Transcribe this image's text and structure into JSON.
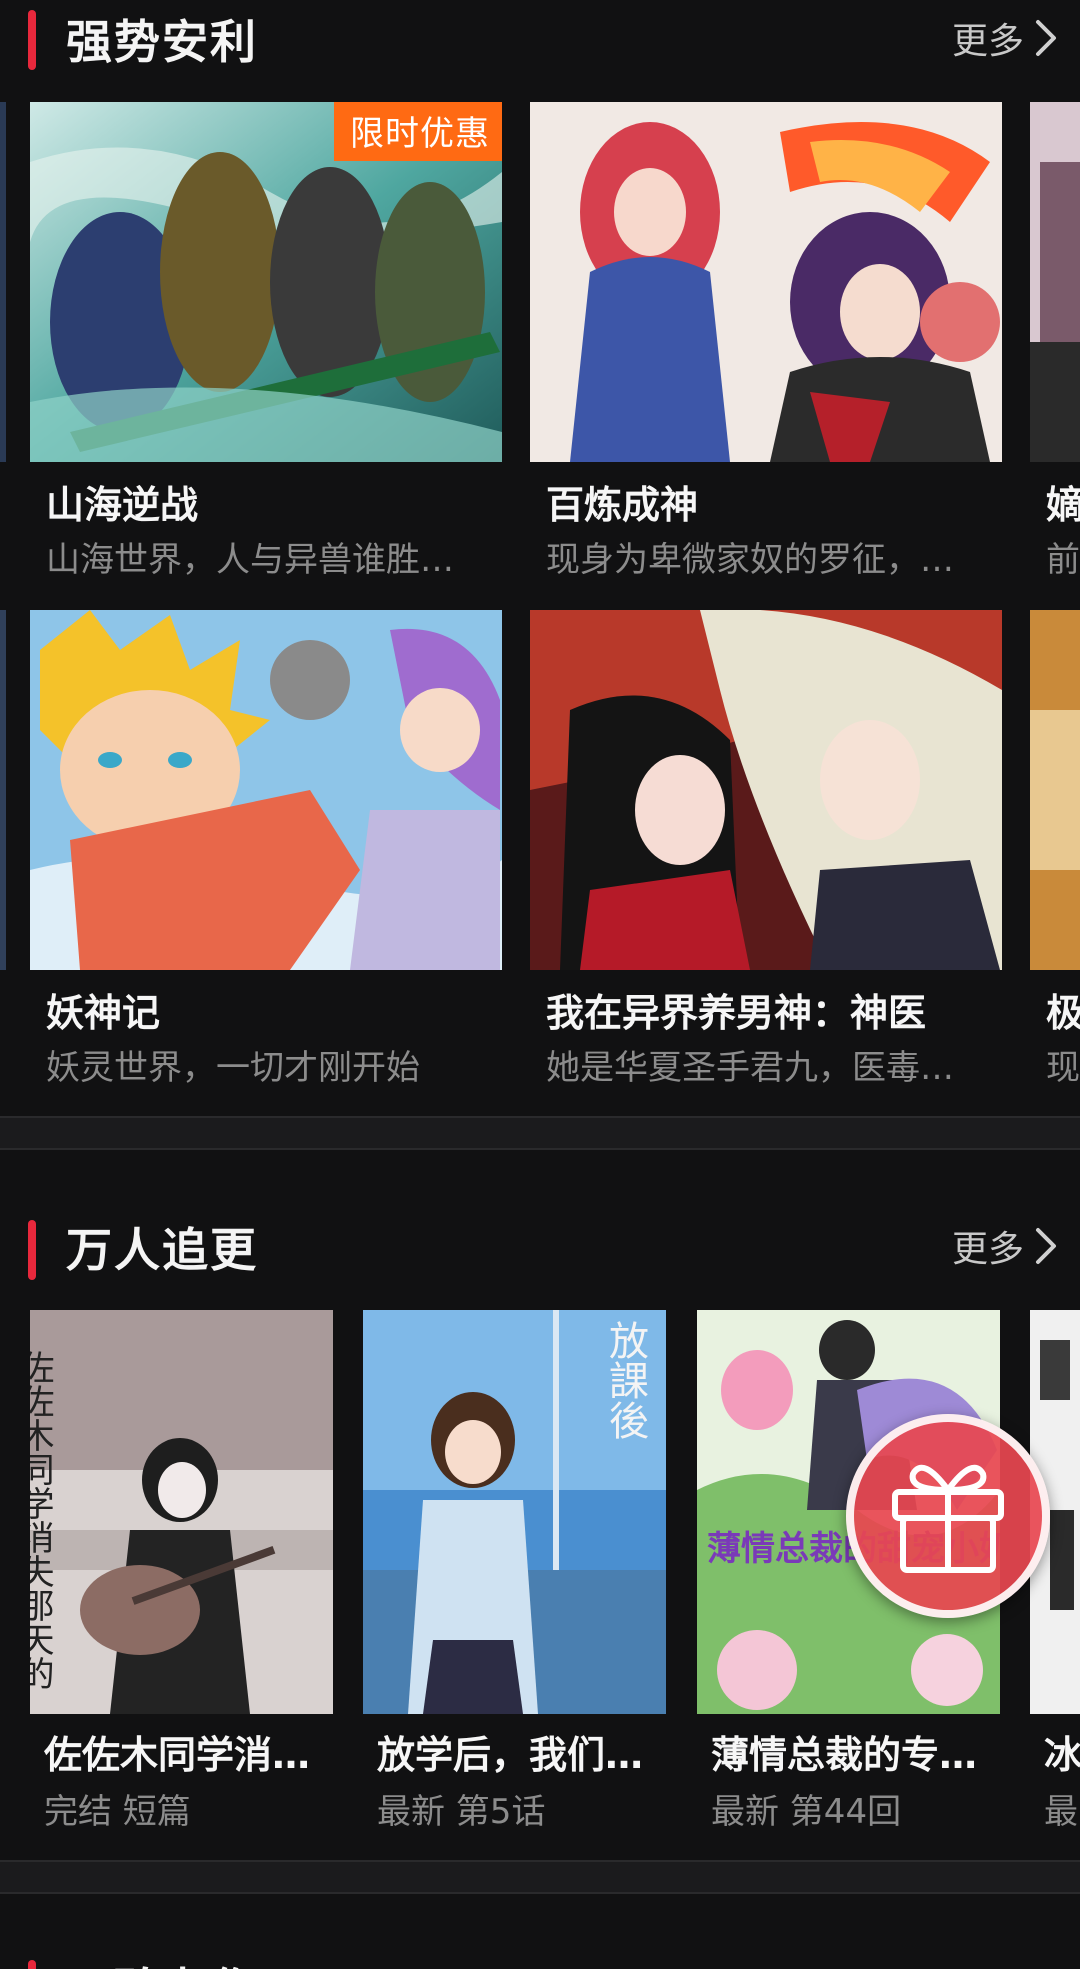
{
  "sections": [
    {
      "title": "强势安利",
      "more": "更多",
      "rows": [
        [
          {
            "title": "山海逆战",
            "desc": "山海世界，人与异兽谁胜…",
            "badge": "限时优惠"
          },
          {
            "title": "百炼成神",
            "desc": "现身为卑微家奴的罗征，…"
          },
          {
            "title": "嫡",
            "desc": "前"
          }
        ],
        [
          {
            "title": "妖神记",
            "desc": "妖灵世界，一切才刚开始"
          },
          {
            "title": "我在异界养男神：神医",
            "desc": "她是华夏圣手君九，医毒…"
          },
          {
            "title": "极",
            "desc": "现"
          }
        ]
      ]
    },
    {
      "title": "万人追更",
      "more": "更多",
      "items": [
        {
          "title": "佐佐木同学消…",
          "meta": "完结 短篇",
          "cover_text": "佐佐木同学消失那天的"
        },
        {
          "title": "放学后，我们…",
          "meta": "最新 第5话",
          "cover_text": "放課後"
        },
        {
          "title": "薄情总裁的专…",
          "meta": "最新 第44回",
          "cover_text": "薄情总裁的甜宠小奶包"
        },
        {
          "title": "冰",
          "meta": "最"
        }
      ]
    },
    {
      "title": "口碑力作"
    }
  ],
  "colors": {
    "accent": "#e8283c",
    "badge": "#ff6a13",
    "background": "#111112",
    "subtext": "#8c8c8c"
  },
  "icons": {
    "more": "chevron-right-icon",
    "gift": "gift-icon"
  }
}
